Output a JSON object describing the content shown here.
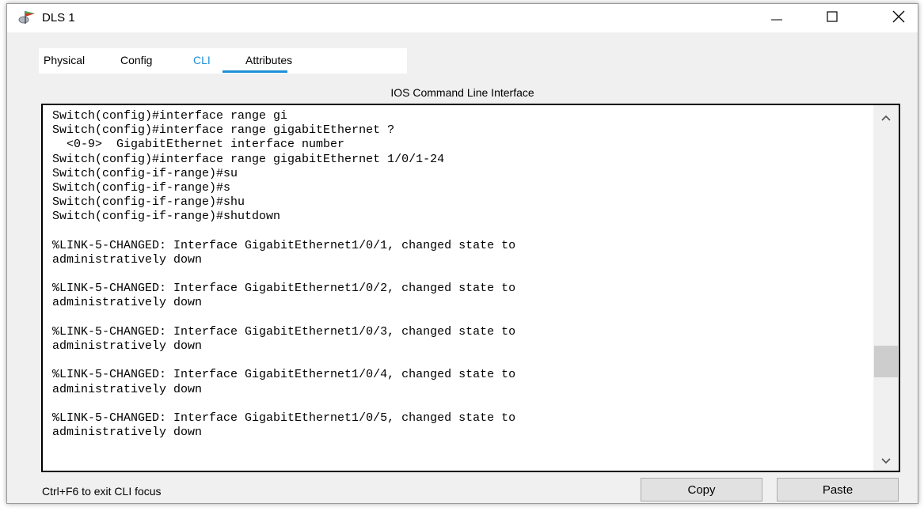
{
  "window": {
    "title": "DLS 1",
    "icon": "router-flag-icon"
  },
  "tabs": [
    {
      "label": "Physical",
      "active": false
    },
    {
      "label": "Config",
      "active": false
    },
    {
      "label": "CLI",
      "active": true
    },
    {
      "label": "Attributes",
      "active": false
    }
  ],
  "panel_title": "IOS Command Line Interface",
  "terminal": {
    "lines": [
      "Switch(config)#interface range gi",
      "Switch(config)#interface range gigabitEthernet ?",
      "  <0-9>  GigabitEthernet interface number",
      "Switch(config)#interface range gigabitEthernet 1/0/1-24",
      "Switch(config-if-range)#su",
      "Switch(config-if-range)#s",
      "Switch(config-if-range)#shu",
      "Switch(config-if-range)#shutdown",
      "",
      "%LINK-5-CHANGED: Interface GigabitEthernet1/0/1, changed state to",
      "administratively down",
      "",
      "%LINK-5-CHANGED: Interface GigabitEthernet1/0/2, changed state to",
      "administratively down",
      "",
      "%LINK-5-CHANGED: Interface GigabitEthernet1/0/3, changed state to",
      "administratively down",
      "",
      "%LINK-5-CHANGED: Interface GigabitEthernet1/0/4, changed state to",
      "administratively down",
      "",
      "%LINK-5-CHANGED: Interface GigabitEthernet1/0/5, changed state to",
      "administratively down"
    ]
  },
  "footer": {
    "status": "Ctrl+F6 to exit CLI focus",
    "copy_label": "Copy",
    "paste_label": "Paste"
  },
  "colors": {
    "accent": "#1e90d8"
  }
}
